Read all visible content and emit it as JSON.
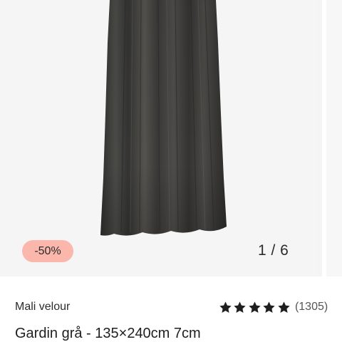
{
  "gallery": {
    "discount_badge": "-50%",
    "slide_counter": "1 / 6",
    "image_icon": "curtain-image"
  },
  "product": {
    "brand": "Mali velour",
    "title": "Gardin grå - 135×240cm 7cm",
    "rating": {
      "stars": 5,
      "max_stars": 5,
      "count_label": "(1305)"
    }
  },
  "colors": {
    "badge_bg": "#fbb7ab",
    "gallery_bg": "#f5f5f5",
    "curtain": "#3a3a38",
    "star": "#1f1f1f"
  }
}
